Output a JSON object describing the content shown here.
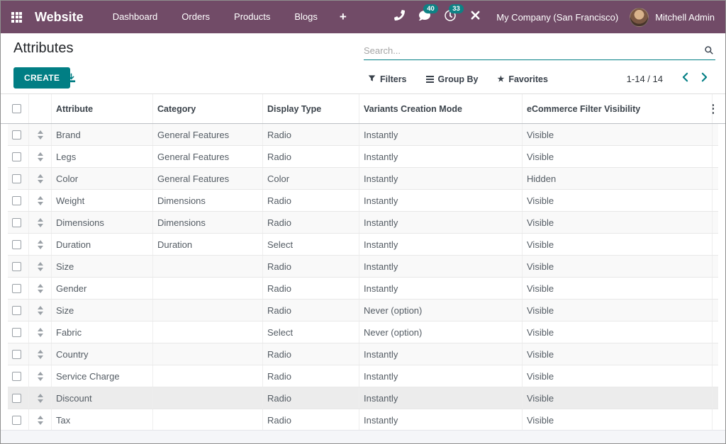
{
  "navbar": {
    "brand": "Website",
    "menu_items": [
      {
        "label": "Dashboard"
      },
      {
        "label": "Orders"
      },
      {
        "label": "Products"
      },
      {
        "label": "Blogs"
      }
    ],
    "plus_label": "+",
    "systray": {
      "messages_count": "40",
      "activities_count": "33",
      "company": "My Company (San Francisco)",
      "user": "Mitchell Admin"
    }
  },
  "page": {
    "title": "Attributes"
  },
  "search": {
    "placeholder": "Search..."
  },
  "toolbar": {
    "create_label": "CREATE"
  },
  "filter_bar": {
    "filters_label": "Filters",
    "group_by_label": "Group By",
    "favorites_label": "Favorites"
  },
  "pager": {
    "range_label": "1-14 / 14"
  },
  "icons": {
    "star_glyph": "★"
  },
  "table": {
    "headers": {
      "attribute": "Attribute",
      "category": "Category",
      "display_type": "Display Type",
      "variants": "Variants Creation Mode",
      "ecommerce": "eCommerce Filter Visibility"
    },
    "rows": [
      {
        "attribute": "Brand",
        "category": "General Features",
        "display_type": "Radio",
        "variants": "Instantly",
        "ecommerce": "Visible"
      },
      {
        "attribute": "Legs",
        "category": "General Features",
        "display_type": "Radio",
        "variants": "Instantly",
        "ecommerce": "Visible"
      },
      {
        "attribute": "Color",
        "category": "General Features",
        "display_type": "Color",
        "variants": "Instantly",
        "ecommerce": "Hidden"
      },
      {
        "attribute": "Weight",
        "category": "Dimensions",
        "display_type": "Radio",
        "variants": "Instantly",
        "ecommerce": "Visible"
      },
      {
        "attribute": "Dimensions",
        "category": "Dimensions",
        "display_type": "Radio",
        "variants": "Instantly",
        "ecommerce": "Visible"
      },
      {
        "attribute": "Duration",
        "category": "Duration",
        "display_type": "Select",
        "variants": "Instantly",
        "ecommerce": "Visible"
      },
      {
        "attribute": "Size",
        "category": "",
        "display_type": "Radio",
        "variants": "Instantly",
        "ecommerce": "Visible"
      },
      {
        "attribute": "Gender",
        "category": "",
        "display_type": "Radio",
        "variants": "Instantly",
        "ecommerce": "Visible"
      },
      {
        "attribute": "Size",
        "category": "",
        "display_type": "Radio",
        "variants": "Never (option)",
        "ecommerce": "Visible"
      },
      {
        "attribute": "Fabric",
        "category": "",
        "display_type": "Select",
        "variants": "Never (option)",
        "ecommerce": "Visible"
      },
      {
        "attribute": "Country",
        "category": "",
        "display_type": "Radio",
        "variants": "Instantly",
        "ecommerce": "Visible"
      },
      {
        "attribute": "Service Charge",
        "category": "",
        "display_type": "Radio",
        "variants": "Instantly",
        "ecommerce": "Visible"
      },
      {
        "attribute": "Discount",
        "category": "",
        "display_type": "Radio",
        "variants": "Instantly",
        "ecommerce": "Visible",
        "highlighted": true
      },
      {
        "attribute": "Tax",
        "category": "",
        "display_type": "Radio",
        "variants": "Instantly",
        "ecommerce": "Visible"
      }
    ]
  },
  "colors": {
    "navbar_bg": "#714B67",
    "accent_teal": "#017e84",
    "badge_teal": "#0e8285",
    "row_stripe": "#f9f9f9",
    "highlight_row": "#ececec"
  }
}
